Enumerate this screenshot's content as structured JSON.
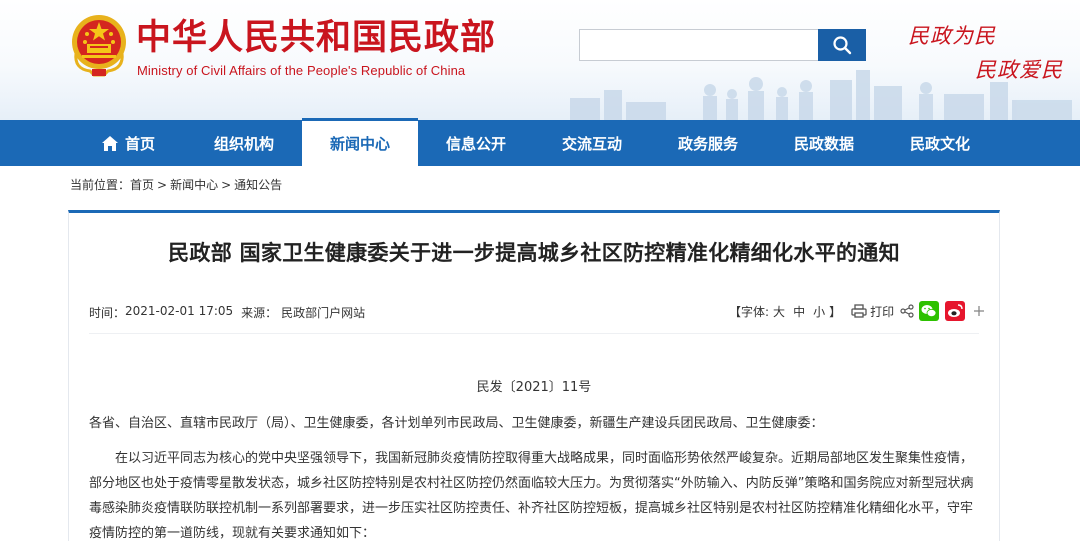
{
  "header": {
    "title_cn": "中华人民共和国民政部",
    "title_en": "Ministry of Civil Affairs of the People's Republic of China",
    "slogan_1": "民政为民",
    "slogan_2": "民政爱民",
    "search": {
      "placeholder": ""
    },
    "colors": {
      "brand_red": "#c9151e",
      "nav_blue": "#1b69b6",
      "search_blue": "#1a5fa6"
    }
  },
  "nav": {
    "items": [
      {
        "label": "首页",
        "icon": "home-icon"
      },
      {
        "label": "组织机构"
      },
      {
        "label": "新闻中心",
        "active": true
      },
      {
        "label": "信息公开"
      },
      {
        "label": "交流互动"
      },
      {
        "label": "政务服务"
      },
      {
        "label": "民政数据"
      },
      {
        "label": "民政文化"
      }
    ]
  },
  "breadcrumb": {
    "prefix": "当前位置：",
    "items": [
      "首页",
      "新闻中心",
      "通知公告"
    ],
    "separator": ">"
  },
  "article": {
    "title": "民政部 国家卫生健康委关于进一步提高城乡社区防控精准化精细化水平的通知",
    "time_label": "时间：",
    "time": "2021-02-01 17:05",
    "source_label": "来源：",
    "source": "民政部门户网站",
    "font_label": "【字体:",
    "font_sizes": [
      "大",
      "中",
      "小"
    ],
    "font_close": "】",
    "print_label": "打印",
    "doc_number": "民发〔2021〕11号",
    "recipients": "各省、自治区、直辖市民政厅（局）、卫生健康委，各计划单列市民政局、卫生健康委，新疆生产建设兵团民政局、卫生健康委：",
    "paragraph": "在以习近平同志为核心的党中央坚强领导下，我国新冠肺炎疫情防控取得重大战略成果，同时面临形势依然严峻复杂。近期局部地区发生聚集性疫情，部分地区也处于疫情零星散发状态，城乡社区防控特别是农村社区防控仍然面临较大压力。为贯彻落实“外防输入、内防反弹”策略和国务院应对新型冠状病毒感染肺炎疫情联防联控机制一系列部署要求，进一步压实社区防控责任、补齐社区防控短板，提高城乡社区特别是农村社区防控精准化精细化水平，守牢疫情防控的第一道防线，现就有关要求通知如下："
  }
}
